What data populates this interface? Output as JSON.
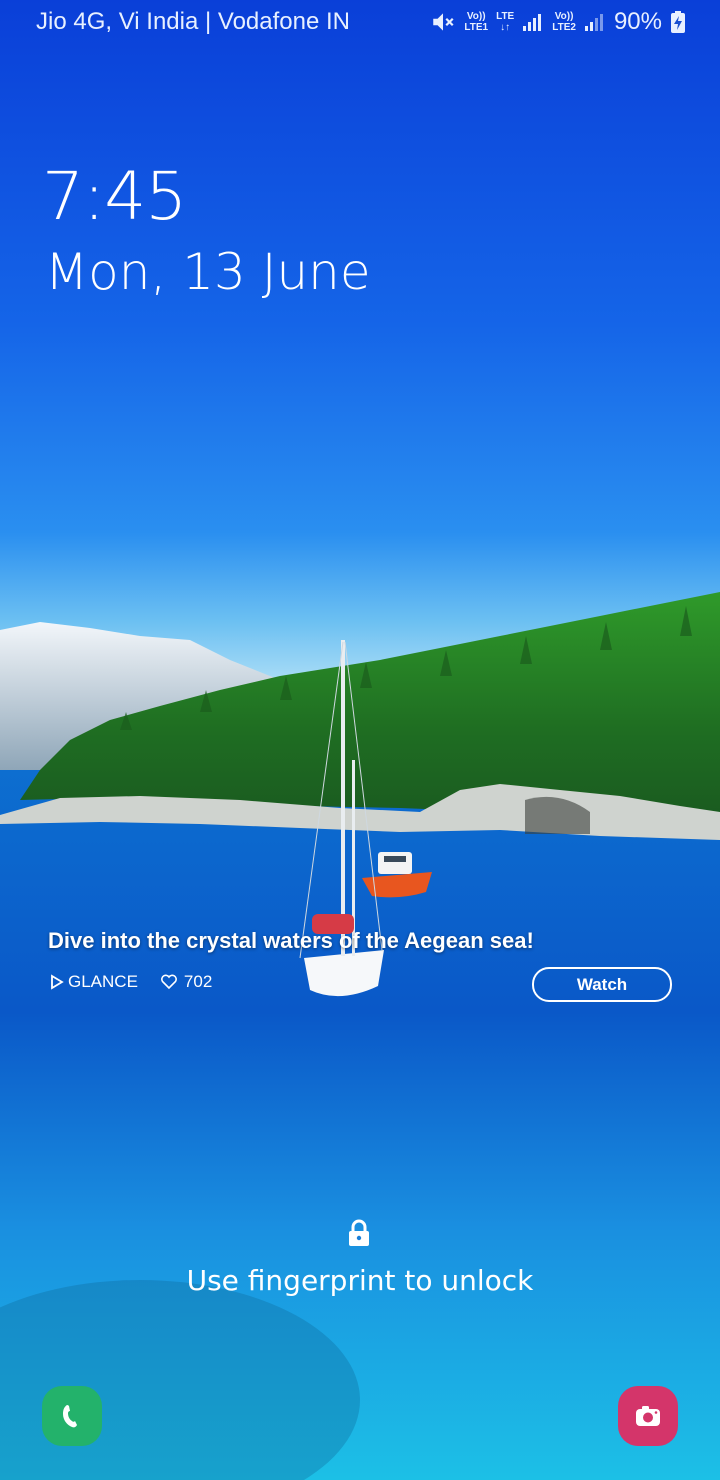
{
  "status_bar": {
    "carrier": "Jio 4G, Vi India | Vodafone IN",
    "sim1_top": "Vo))",
    "sim1_bottom": "LTE1",
    "network_type": "LTE",
    "sim2_top": "Vo))",
    "sim2_bottom": "LTE2",
    "battery_percent": "90%",
    "icons": [
      "mute-icon",
      "signal-icon",
      "battery-charging-icon"
    ]
  },
  "lockscreen": {
    "time": "7:45",
    "date": "Mon, 13 June",
    "unlock_hint": "Use fingerprint to unlock",
    "lock_icon": "lock-icon"
  },
  "glance": {
    "title": "Dive into the crystal waters of the Aegean sea!",
    "brand": "GLANCE",
    "likes": "702",
    "watch_label": "Watch"
  },
  "shortcuts": {
    "left": "phone-icon",
    "right": "camera-icon",
    "left_color": "#23b26b",
    "right_color": "#d4356a"
  }
}
